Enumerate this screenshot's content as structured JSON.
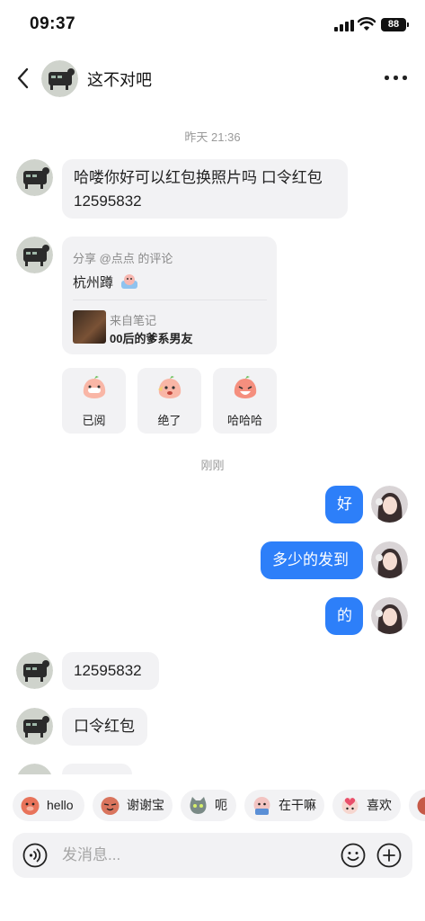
{
  "status_bar": {
    "time": "09:37",
    "battery": "88"
  },
  "header": {
    "title": "这不对吧",
    "back_icon": "chevron-left-icon",
    "more_icon": "more-dots-icon"
  },
  "chat": {
    "timestamp_1": "昨天 21:36",
    "msg_1": "哈喽你好可以红包换照片吗 口令红包 12595832",
    "share": {
      "from": "分享 @点点 的评论",
      "text": "杭州蹲",
      "note_label": "来自笔记",
      "note_title": "00后的爹系男友"
    },
    "reactions": [
      "已阅",
      "绝了",
      "哈哈哈"
    ],
    "timestamp_2": "刚刚",
    "out_1": "好",
    "out_2": "多少的发到",
    "out_3": "的",
    "in_2": "12595832",
    "in_3": "口令红包"
  },
  "quick_replies": [
    "hello",
    "谢谢宝",
    "呃",
    "在干嘛",
    "喜欢"
  ],
  "input": {
    "placeholder": "发消息..."
  },
  "colors": {
    "accent": "#2d7ff9",
    "bubble_in": "#f2f2f4"
  }
}
